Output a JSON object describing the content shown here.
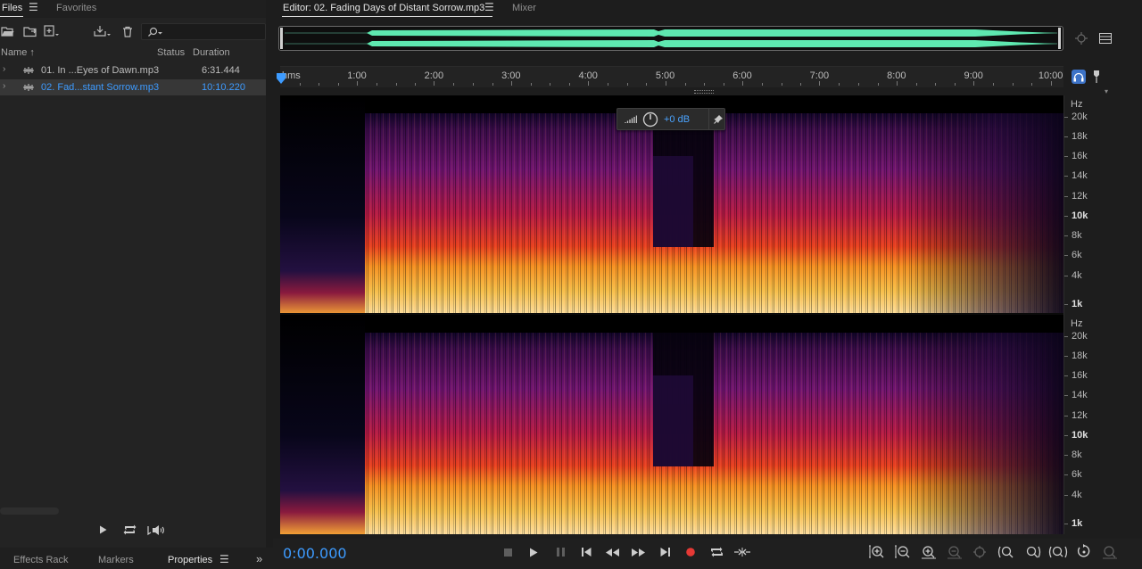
{
  "files_panel": {
    "tabs": [
      {
        "label": "Files",
        "active": true
      },
      {
        "label": "Favorites",
        "active": false
      }
    ],
    "menu_icon": "hamburger-menu-icon",
    "toolbar_icons": [
      "open-file-icon",
      "import-icon",
      "new-file-icon",
      "save-icon",
      "delete-icon"
    ],
    "search": {
      "value": "",
      "icon": "search-icon"
    },
    "columns": {
      "name": "Name",
      "sort_indicator": "↑",
      "status": "Status",
      "duration": "Duration"
    },
    "files": [
      {
        "name": "01. In ...Eyes of Dawn.mp3",
        "duration": "6:31.444",
        "selected": false
      },
      {
        "name": "02. Fad...stant Sorrow.mp3",
        "duration": "10:10.220",
        "selected": true
      }
    ],
    "preview_controls": [
      "play-icon",
      "loop-icon",
      "autoplay-icon"
    ]
  },
  "bottom_tabs": [
    {
      "label": "Effects Rack",
      "active": false
    },
    {
      "label": "Markers",
      "active": false
    },
    {
      "label": "Properties",
      "active": true
    }
  ],
  "editor": {
    "tabs": [
      {
        "label": "Editor: 02. Fading Days of Distant Sorrow.mp3",
        "active": true
      },
      {
        "label": "Mixer",
        "active": false
      }
    ],
    "ruler": {
      "unit_label": "hms",
      "ticks": [
        "1:00",
        "2:00",
        "3:00",
        "4:00",
        "5:00",
        "6:00",
        "7:00",
        "8:00",
        "9:00",
        "10:00"
      ]
    },
    "hz_scale": {
      "unit": "Hz",
      "labels": [
        {
          "text": "20k",
          "bold": false
        },
        {
          "text": "18k",
          "bold": false
        },
        {
          "text": "16k",
          "bold": false
        },
        {
          "text": "14k",
          "bold": false
        },
        {
          "text": "12k",
          "bold": false
        },
        {
          "text": "10k",
          "bold": true
        },
        {
          "text": "8k",
          "bold": false
        },
        {
          "text": "6k",
          "bold": false
        },
        {
          "text": "4k",
          "bold": false
        },
        {
          "text": "1k",
          "bold": true
        }
      ]
    },
    "hud": {
      "gain": "+0 dB",
      "icons": [
        "level-meter-icon",
        "gain-knob-icon",
        "pin-icon"
      ]
    },
    "timecode": "0:00.000",
    "transport": [
      "stop-icon",
      "play-icon",
      "pause-icon",
      "go-to-start-icon",
      "rewind-icon",
      "fast-forward-icon",
      "go-to-end-icon",
      "record-icon",
      "loop-playback-icon",
      "skip-selection-icon"
    ],
    "zoom_controls": [
      "zoom-in-amplitude-icon",
      "zoom-out-amplitude-icon",
      "zoom-in-time-icon",
      "zoom-out-time-icon",
      "zoom-full-icon",
      "zoom-in-point-icon",
      "zoom-out-point-icon",
      "zoom-selection-icon",
      "zoom-reset-icon",
      "zoom-tracks-icon"
    ],
    "colors": {
      "accent": "#3d9bff",
      "waveform": "#5ee8b0",
      "record": "#e53935"
    }
  }
}
